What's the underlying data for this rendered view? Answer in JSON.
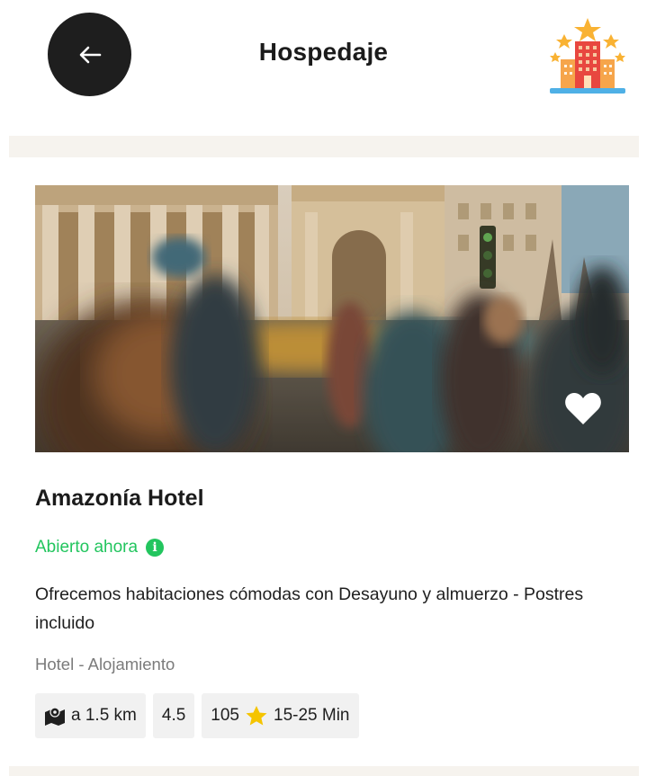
{
  "header": {
    "title": "Hospedaje",
    "back_icon": "arrow-left-icon",
    "brand_icon": "hotel-stars-icon"
  },
  "listing": {
    "name": "Amazonía Hotel",
    "status": "Abierto ahora",
    "description": "Ofrecemos habitaciones cómodas con Desayuno y almuerzo - Postres incluido",
    "category": "Hotel - Alojamiento",
    "favorite_icon": "heart-icon",
    "chips": {
      "distance": "a 1.5 km",
      "rating": "4.5",
      "reviews": "105",
      "delivery_time": "15-25 Min"
    }
  },
  "colors": {
    "status_green": "#22c55e",
    "back_button_bg": "#1e1e1e",
    "divider": "#f6f3ee",
    "chip_bg": "#f1f1f1",
    "star": "#f5c400"
  }
}
